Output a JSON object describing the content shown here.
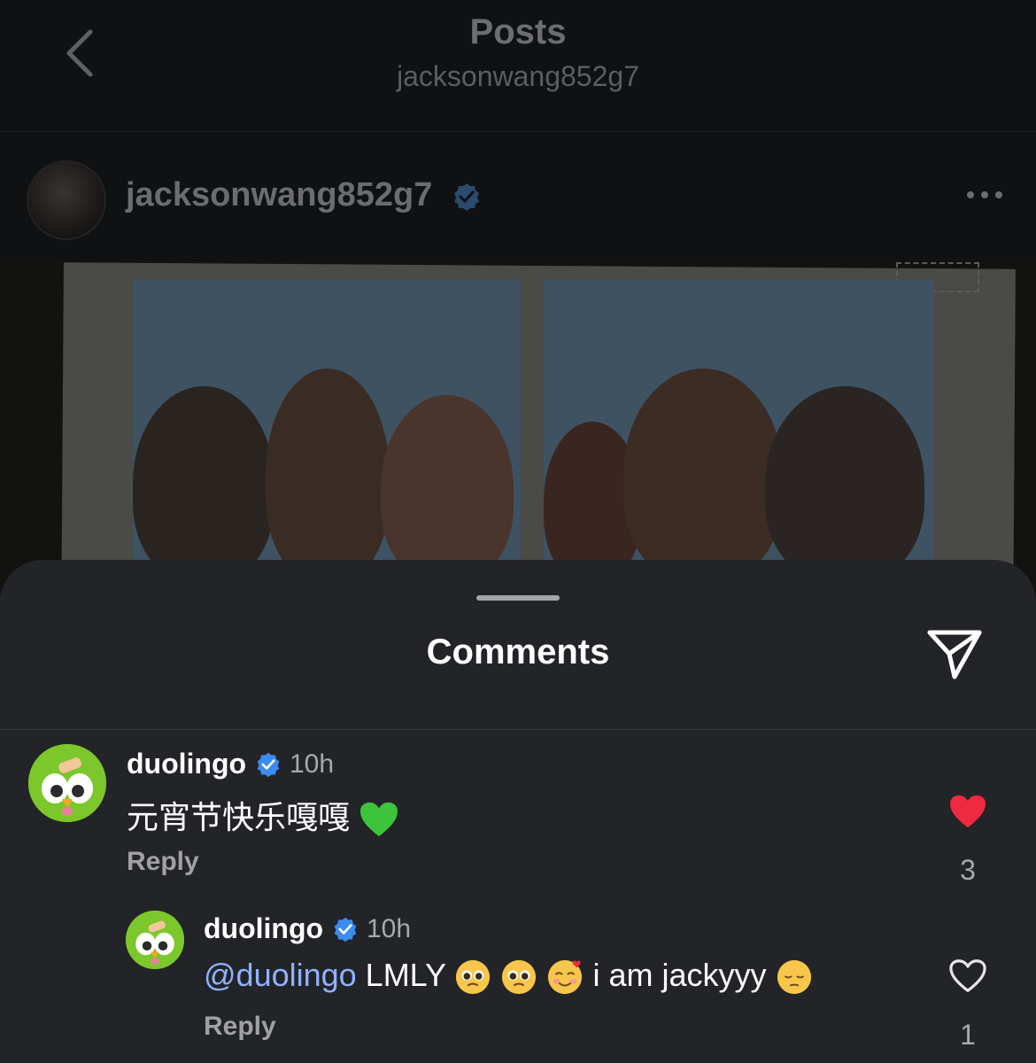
{
  "header": {
    "title": "Posts",
    "subtitle": "jacksonwang852g7"
  },
  "post": {
    "username": "jacksonwang852g7"
  },
  "comments_sheet": {
    "title": "Comments",
    "comments": [
      {
        "username": "duolingo",
        "time": "10h",
        "text": "元宵节快乐嘎嘎",
        "reply_label": "Reply",
        "likes": "3",
        "liked": true
      },
      {
        "username": "duolingo",
        "time": "10h",
        "mention": "@duolingo",
        "text": " LMLY",
        "text_tail": " i am jackyyy",
        "reply_label": "Reply",
        "likes": "1",
        "liked": false
      }
    ]
  },
  "colors": {
    "heart_liked": "#ed2a3f",
    "verified": "#3b8bf0",
    "mention": "#8fb2ff",
    "duolingo_green": "#7cc72c"
  }
}
